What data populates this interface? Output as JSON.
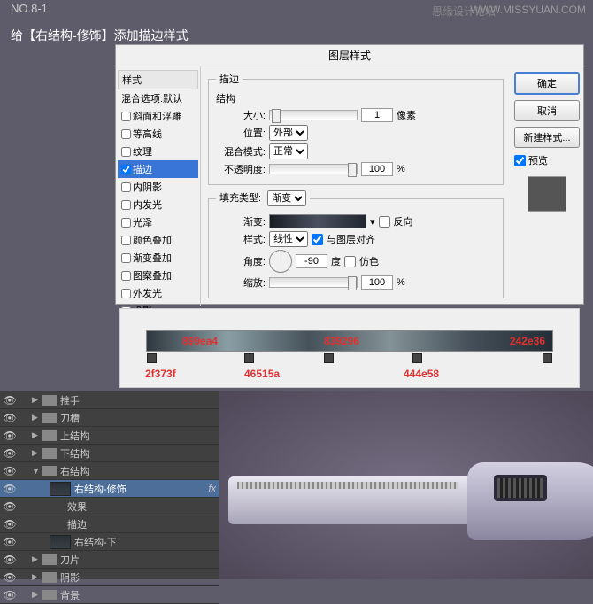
{
  "step": "NO.8-1",
  "step_text": "给【右结构-修饰】添加描边样式",
  "watermark1": "WWW.MISSYUAN.COM",
  "watermark2": "思缘设计论坛",
  "dialog": {
    "title": "图层样式",
    "styles_header": "样式",
    "blend_default": "混合选项:默认",
    "items": [
      {
        "label": "斜面和浮雕",
        "checked": false
      },
      {
        "label": "等高线",
        "checked": false
      },
      {
        "label": "纹理",
        "checked": false
      },
      {
        "label": "描边",
        "checked": true,
        "selected": true
      },
      {
        "label": "内阴影",
        "checked": false
      },
      {
        "label": "内发光",
        "checked": false
      },
      {
        "label": "光泽",
        "checked": false
      },
      {
        "label": "颜色叠加",
        "checked": false
      },
      {
        "label": "渐变叠加",
        "checked": false
      },
      {
        "label": "图案叠加",
        "checked": false
      },
      {
        "label": "外发光",
        "checked": false
      },
      {
        "label": "投影",
        "checked": false
      }
    ],
    "stroke": {
      "legend": "描边",
      "structure": "结构",
      "size_label": "大小:",
      "size_value": "1",
      "size_unit": "像素",
      "position_label": "位置:",
      "position_value": "外部",
      "blend_label": "混合模式:",
      "blend_value": "正常",
      "opacity_label": "不透明度:",
      "opacity_value": "100",
      "opacity_unit": "%",
      "fill_legend": "填充类型:",
      "fill_value": "渐变",
      "gradient_label": "渐变:",
      "reverse_label": "反向",
      "style_label": "样式:",
      "style_value": "线性",
      "align_label": "与图层对齐",
      "angle_label": "角度:",
      "angle_value": "-90",
      "angle_unit": "度",
      "dither_label": "仿色",
      "scale_label": "缩放:",
      "scale_value": "100",
      "scale_unit": "%"
    },
    "buttons": {
      "ok": "确定",
      "cancel": "取消",
      "new": "新建样式...",
      "preview": "预览"
    }
  },
  "gradient": {
    "top_labels": [
      "899ea4",
      "839296",
      "242e36"
    ],
    "bottom_labels": [
      "2f373f",
      "46515a",
      "444e58"
    ]
  },
  "layers": [
    {
      "name": "推手",
      "folder": true
    },
    {
      "name": "刀槽",
      "folder": true
    },
    {
      "name": "上结构",
      "folder": true
    },
    {
      "name": "下结构",
      "folder": true
    },
    {
      "name": "右结构",
      "folder": true,
      "open": true
    },
    {
      "name": "右结构-修饰",
      "thumb": true,
      "selected": true,
      "fx": "fx",
      "indent": 2
    },
    {
      "name": "效果",
      "indent": 3
    },
    {
      "name": "描边",
      "indent": 3
    },
    {
      "name": "右结构-下",
      "thumb": true,
      "indent": 2
    },
    {
      "name": "刀片",
      "folder": true
    },
    {
      "name": "阴影",
      "folder": true
    },
    {
      "name": "背景",
      "folder": true
    }
  ]
}
